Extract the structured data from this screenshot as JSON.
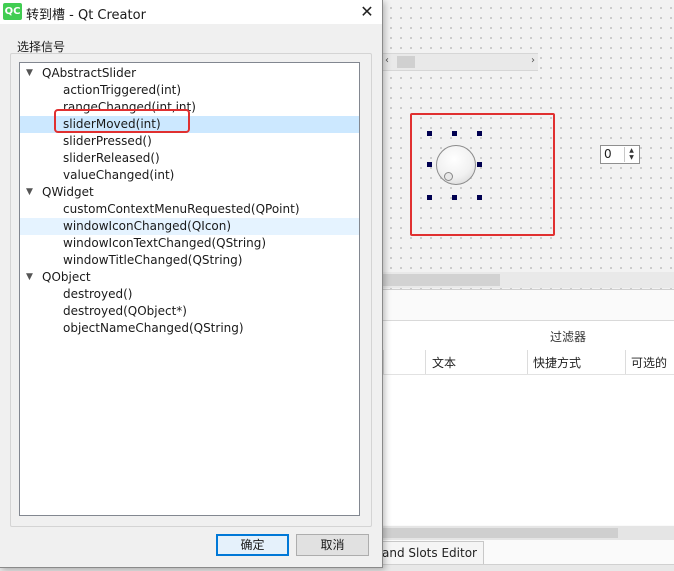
{
  "dialog": {
    "app_icon_text": "QC",
    "title": "转到槽 - Qt Creator",
    "close_glyph": "✕",
    "group_label": "选择信号",
    "ok_label": "确定",
    "cancel_label": "取消"
  },
  "tree": [
    {
      "label": "QAbstractSlider",
      "level": 0,
      "expanded": true
    },
    {
      "label": "actionTriggered(int)",
      "level": 1
    },
    {
      "label": "rangeChanged(int,int)",
      "level": 1
    },
    {
      "label": "sliderMoved(int)",
      "level": 1,
      "selected": true
    },
    {
      "label": "sliderPressed()",
      "level": 1
    },
    {
      "label": "sliderReleased()",
      "level": 1
    },
    {
      "label": "valueChanged(int)",
      "level": 1
    },
    {
      "label": "QWidget",
      "level": 0,
      "expanded": true
    },
    {
      "label": "customContextMenuRequested(QPoint)",
      "level": 1
    },
    {
      "label": "windowIconChanged(QIcon)",
      "level": 1,
      "hover": true
    },
    {
      "label": "windowIconTextChanged(QString)",
      "level": 1
    },
    {
      "label": "windowTitleChanged(QString)",
      "level": 1
    },
    {
      "label": "QObject",
      "level": 0,
      "expanded": true
    },
    {
      "label": "destroyed()",
      "level": 1
    },
    {
      "label": "destroyed(QObject*)",
      "level": 1
    },
    {
      "label": "objectNameChanged(QString)",
      "level": 1
    }
  ],
  "designer": {
    "spinbox_value": "0",
    "filter_label": "过滤器",
    "columns": [
      "文本",
      "快捷方式",
      "可选的"
    ],
    "bottom_tab_label": "and Slots Editor"
  },
  "colors": {
    "selection": "#cce8ff",
    "annotation_red": "#e03030",
    "primary_button_border": "#0078d7"
  }
}
